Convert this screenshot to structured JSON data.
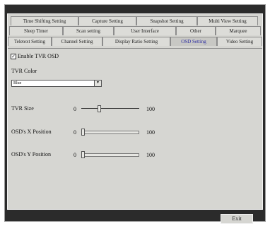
{
  "tabs": {
    "row1": [
      "Time Shifting Setting",
      "Capture Setting",
      "Snapshot Setting",
      "Multi View Setting"
    ],
    "row2": [
      "Sleep Timer",
      "Scan setting",
      "User Interface",
      "Other",
      "Marquee"
    ],
    "row3": [
      "Teletext Setting",
      "Channel Setting",
      "Display Ratio Setting",
      "OSD Setting",
      "Video Setting"
    ],
    "active": "OSD Setting"
  },
  "osd": {
    "enable_label": "Enable TVR OSD",
    "enable_checked": true,
    "color_label": "TVR Color",
    "color_value": "Blue",
    "size_label": "TVR Size",
    "size_min": "0",
    "size_max": "100",
    "size_value": 30,
    "x_label": "OSD's X Position",
    "x_min": "0",
    "x_max": "100",
    "x_value": 0,
    "y_label": "OSD's Y Position",
    "y_min": "0",
    "y_max": "100",
    "y_value": 0
  },
  "footer": {
    "exit_label": "Exit"
  }
}
